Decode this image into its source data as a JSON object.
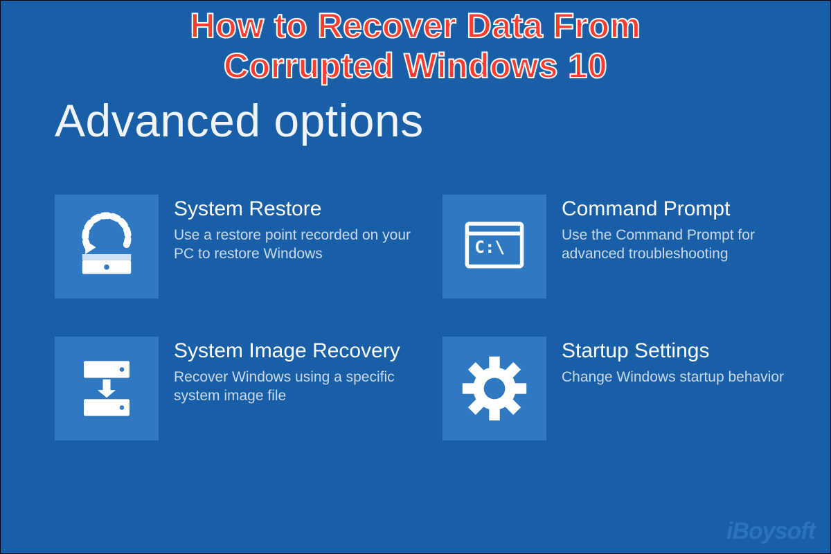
{
  "overlay": {
    "line1": "How to Recover Data From",
    "line2": "Corrupted Windows 10"
  },
  "heading": "Advanced options",
  "options": [
    {
      "title": "System Restore",
      "desc": "Use a restore point recorded on your PC to restore Windows"
    },
    {
      "title": "Command Prompt",
      "desc": "Use the Command Prompt for advanced troubleshooting"
    },
    {
      "title": "System Image Recovery",
      "desc": "Recover Windows using a specific system image file"
    },
    {
      "title": "Startup Settings",
      "desc": "Change Windows startup behavior"
    }
  ],
  "watermark": "iBoysoft"
}
